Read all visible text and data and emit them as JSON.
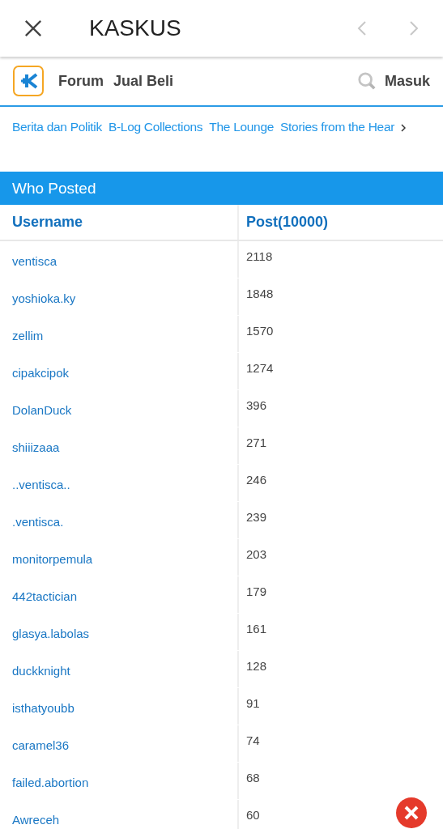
{
  "top_bar": {
    "title": "KASKUS"
  },
  "nav": {
    "links": [
      "Forum",
      "Jual Beli"
    ],
    "login": "Masuk"
  },
  "categories": [
    "Berita dan Politik",
    "B-Log Collections",
    "The Lounge",
    "Stories from the Hear"
  ],
  "panel": {
    "title": "Who Posted"
  },
  "table": {
    "columns": [
      "Username",
      "Post(10000)"
    ],
    "rows": [
      {
        "username": "ventisca",
        "posts": "2118"
      },
      {
        "username": "yoshioka.ky",
        "posts": "1848"
      },
      {
        "username": "zellim",
        "posts": "1570"
      },
      {
        "username": "cipakcipok",
        "posts": "1274"
      },
      {
        "username": "DolanDuck",
        "posts": "396"
      },
      {
        "username": "shiiizaaa",
        "posts": "271"
      },
      {
        "username": "..ventisca..",
        "posts": "246"
      },
      {
        "username": ".ventisca.",
        "posts": "239"
      },
      {
        "username": "monitorpemula",
        "posts": "203"
      },
      {
        "username": "442tactician",
        "posts": "179"
      },
      {
        "username": "glasya.labolas",
        "posts": "161"
      },
      {
        "username": "duckknight",
        "posts": "128"
      },
      {
        "username": "isthatyoubb",
        "posts": "91"
      },
      {
        "username": "caramel36",
        "posts": "74"
      },
      {
        "username": "failed.abortion",
        "posts": "68"
      },
      {
        "username": "Awreceh",
        "posts": "60"
      }
    ]
  }
}
